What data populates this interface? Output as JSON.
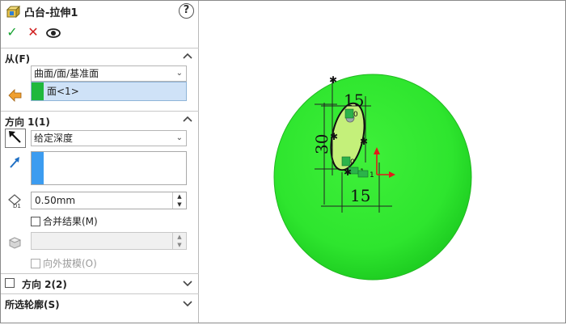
{
  "header": {
    "title": "凸台-拉伸1",
    "help": "?"
  },
  "actions": {
    "ok": "✓",
    "cancel": "✕"
  },
  "from_section": {
    "label": "从(F)",
    "select_value": "曲面/面/基准面",
    "face_item": "面<1>"
  },
  "direction1": {
    "label": "方向 1(1)",
    "end_condition": "给定深度",
    "depth_value": "0.50mm",
    "merge_label": "合并结果(M)",
    "draft_value": "",
    "draft_outward_label": "向外拔模(O)"
  },
  "direction2": {
    "label": "方向 2(2)"
  },
  "contours": {
    "label": "所选轮廓(S)"
  },
  "viewport": {
    "dimensions": [
      "15",
      "30",
      "15"
    ],
    "relation_marks": [
      "0",
      "0",
      "1",
      "1"
    ],
    "colors": {
      "disk": "#2ee52e",
      "profile": "#c4f07a",
      "arrow": "#e01a1a"
    }
  }
}
